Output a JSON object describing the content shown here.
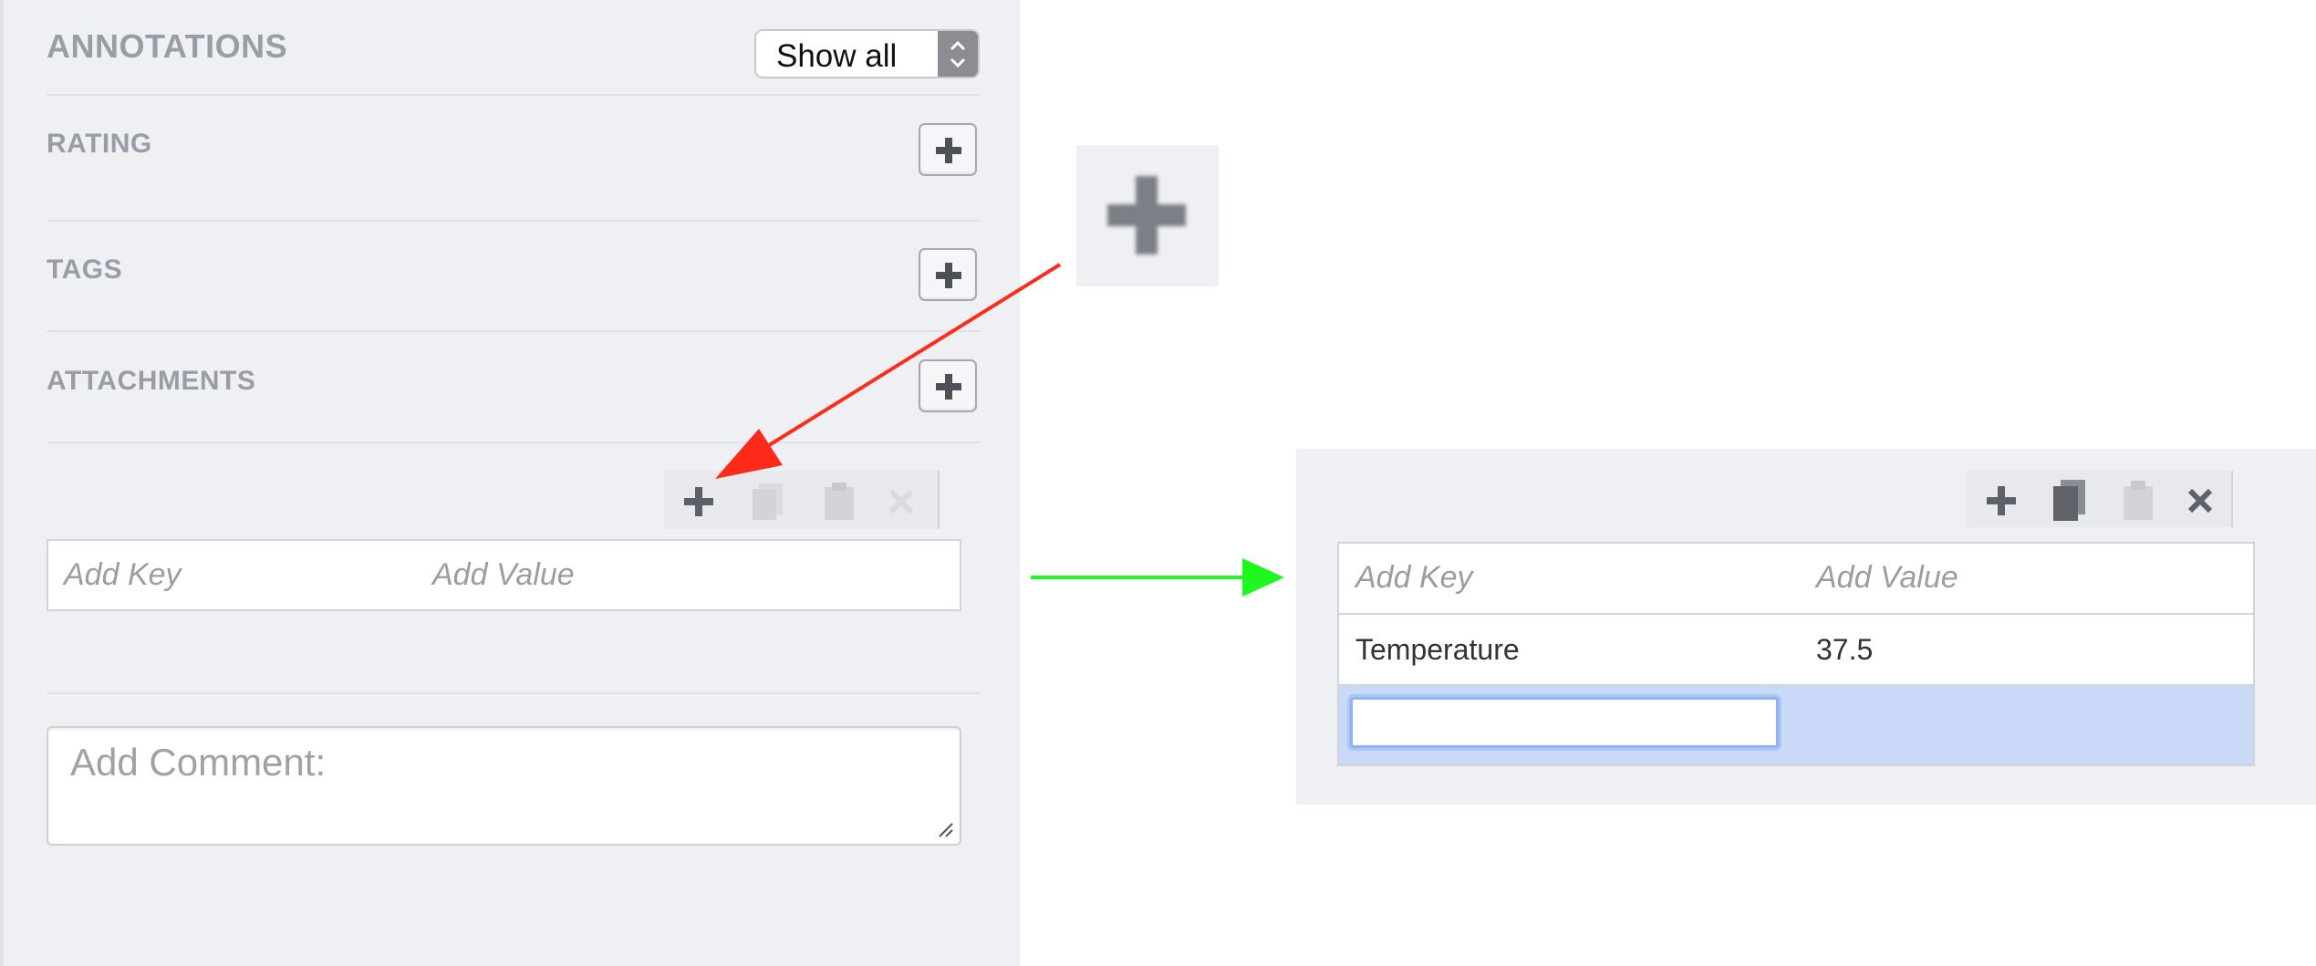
{
  "panel": {
    "title": "ANNOTATIONS",
    "filter_select": {
      "value": "Show all"
    },
    "sections": {
      "rating": "RATING",
      "tags": "TAGS",
      "attachments": "ATTACHMENTS"
    },
    "kv_table": {
      "key_placeholder": "Add Key",
      "value_placeholder": "Add Value"
    },
    "comment": {
      "placeholder": "Add Comment:"
    }
  },
  "result_panel": {
    "kv_table": {
      "key_placeholder": "Add Key",
      "value_placeholder": "Add Value",
      "rows": [
        {
          "key": "Temperature",
          "value": "37.5"
        }
      ],
      "new_row_key_value": "",
      "selected_row_color": "#cad9f7"
    }
  },
  "annotation_arrows": {
    "red_arrow_color": "#ff2a1a",
    "green_arrow_color": "#1ef81e"
  },
  "icons": {
    "add": "plus-icon",
    "copy": "copy-icon",
    "paste": "paste-icon",
    "delete": "close-icon",
    "select_arrows": "updown-arrows-icon",
    "resize": "resize-grip-icon"
  }
}
